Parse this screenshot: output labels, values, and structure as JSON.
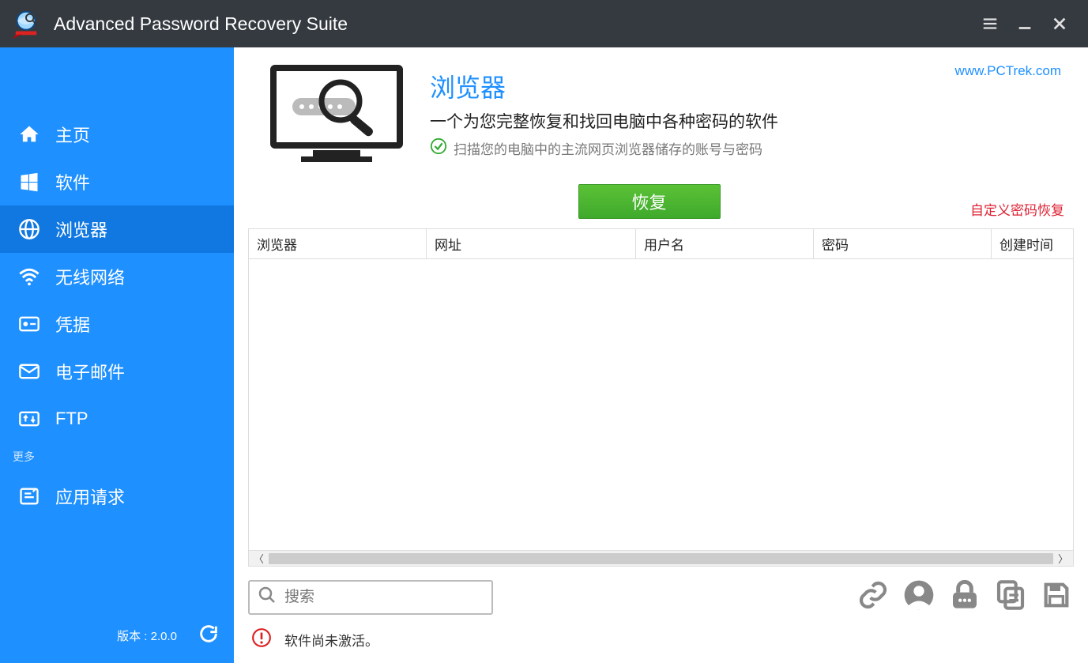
{
  "titlebar": {
    "title": "Advanced Password Recovery Suite"
  },
  "sidebar": {
    "items": [
      {
        "label": "主页"
      },
      {
        "label": "软件"
      },
      {
        "label": "浏览器"
      },
      {
        "label": "无线网络"
      },
      {
        "label": "凭据"
      },
      {
        "label": "电子邮件"
      },
      {
        "label": "FTP"
      }
    ],
    "more_label": "更多",
    "more_items": [
      {
        "label": "应用请求"
      }
    ],
    "version_prefix": "版本 : ",
    "version": "2.0.0"
  },
  "hero": {
    "title": "浏览器",
    "subtitle": "一个为您完整恢复和找回电脑中各种密码的软件",
    "check_text": "扫描您的电脑中的主流网页浏览器储存的账号与密码",
    "link": "www.PCTrek.com"
  },
  "actions": {
    "recover": "恢复",
    "custom_recover": "自定义密码恢复"
  },
  "table": {
    "columns": [
      "浏览器",
      "网址",
      "用户名",
      "密码",
      "创建时间"
    ],
    "rows": []
  },
  "search": {
    "placeholder": "搜索"
  },
  "status": {
    "message": "软件尚未激活。"
  },
  "colors": {
    "accent": "#1e90ff",
    "green": "#4caf50",
    "danger": "#d22"
  }
}
